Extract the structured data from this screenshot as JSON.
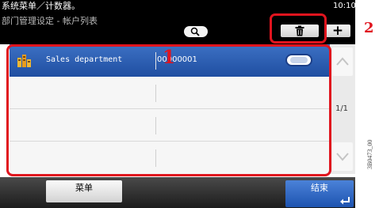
{
  "header": {
    "title": "系统菜单／计数器。",
    "time": "10:10",
    "subtitle": "部门管理设定 - 帐户列表"
  },
  "table": {
    "rows": [
      {
        "name": "Sales department",
        "id": "00000001",
        "selected": true
      },
      {
        "name": "",
        "id": "",
        "selected": false
      },
      {
        "name": "",
        "id": "",
        "selected": false
      },
      {
        "name": "",
        "id": "",
        "selected": false
      }
    ]
  },
  "pagination": {
    "page_text": "1/1"
  },
  "footer": {
    "menu_label": "菜单",
    "end_label": "结束"
  },
  "callouts": {
    "first": "1",
    "second": "2"
  },
  "doc_id": "3B0473_00",
  "icons": {
    "search": "search-icon",
    "delete": "trash-icon",
    "add": "plus-icon",
    "department": "department-icon",
    "detail": "detail-icon",
    "scroll_up": "chevron-up-icon",
    "scroll_down": "chevron-down-icon",
    "enter": "enter-icon"
  },
  "colors": {
    "accent_blue": "#2a5db4",
    "callout_red": "#e0141e",
    "header_black": "#000000"
  }
}
